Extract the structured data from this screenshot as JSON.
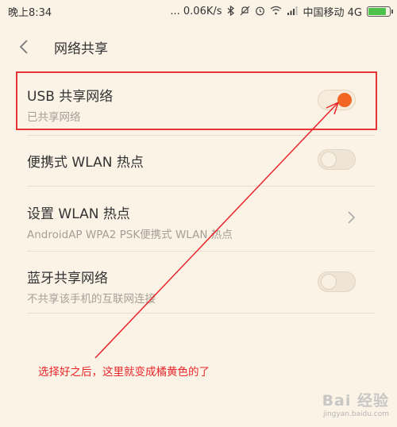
{
  "status_bar": {
    "time": "晚上8:34",
    "speed": "... 0.06K/s",
    "carrier": "中国移动 4G",
    "icons": [
      "bluetooth-icon",
      "mute-icon",
      "alarm-icon",
      "wifi-icon",
      "signal-icon",
      "battery-icon"
    ],
    "battery_level": 0.85
  },
  "header": {
    "back_icon": "chevron-left-icon",
    "title": "网络共享"
  },
  "settings": [
    {
      "title": "USB 共享网络",
      "subtitle": "已共享网络",
      "control": "toggle",
      "on": true
    },
    {
      "title": "便携式 WLAN 热点",
      "subtitle": "",
      "control": "toggle",
      "on": false
    },
    {
      "title": "设置 WLAN 热点",
      "subtitle": "AndroidAP WPA2 PSK便携式 WLAN 热点",
      "control": "chevron",
      "on": false
    },
    {
      "title": "蓝牙共享网络",
      "subtitle": "不共享该手机的互联网连接",
      "control": "toggle",
      "on": false
    }
  ],
  "annotation": {
    "text": "选择好之后，这里就变成橘黄色的了"
  },
  "watermark": {
    "main": "Bai 经验",
    "sub": "jingyan.baidu.com"
  },
  "colors": {
    "background": "#fbf3e6",
    "accent_on": "#f26522",
    "annotation_red": "#e8262c"
  }
}
